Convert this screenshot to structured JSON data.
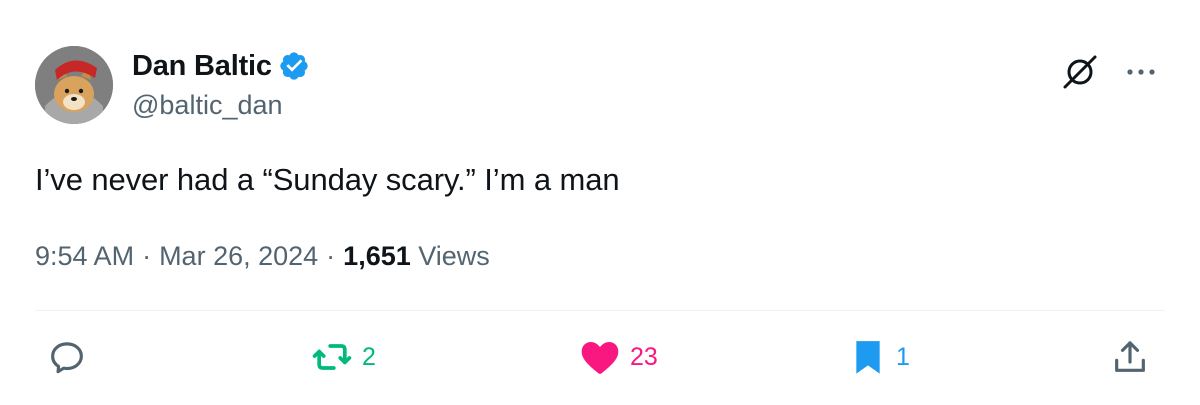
{
  "author": {
    "name": "Dan Baltic",
    "handle": "@baltic_dan",
    "verified": true,
    "avatar_icon": "doge-avatar",
    "badge_color": "#1d9bf0"
  },
  "tweet": {
    "text": "I’ve never had a “Sunday scary.” I’m a man"
  },
  "meta": {
    "time": "9:54 AM",
    "separator": "·",
    "date": "Mar 26, 2024",
    "views_count": "1,651",
    "views_label": "Views"
  },
  "actions": {
    "reply": {
      "icon": "reply-icon",
      "count": ""
    },
    "retweet": {
      "icon": "retweet-icon",
      "count": "2",
      "color": "#00ba7c"
    },
    "like": {
      "icon": "heart-icon",
      "count": "23",
      "color": "#f91880"
    },
    "bookmark": {
      "icon": "bookmark-icon",
      "count": "1",
      "color": "#1d9bf0"
    },
    "share": {
      "icon": "share-icon"
    }
  },
  "top_icons": [
    "grok-icon",
    "more-icon"
  ]
}
